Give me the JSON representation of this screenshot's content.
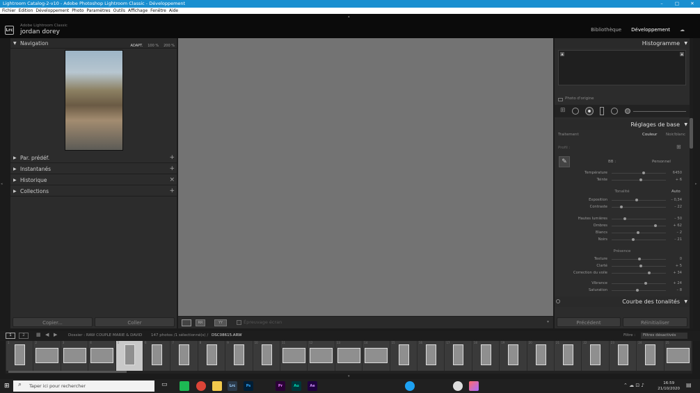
{
  "window": {
    "title": "Lightroom Catalog-2-v10 - Adobe Photoshop Lightroom Classic - Développement",
    "min": "–",
    "max": "□",
    "close": "✕"
  },
  "menu": [
    "Fichier",
    "Edition",
    "Développement",
    "Photo",
    "Paramètres",
    "Outils",
    "Affichage",
    "Fenêtre",
    "Aide"
  ],
  "identity": {
    "logo": "Lrc",
    "app": "Adobe Lightroom Classic",
    "user": "jordan dorey",
    "modules": [
      "Bibliothèque",
      "Développement"
    ],
    "active_module": "Développement"
  },
  "left": {
    "navigator": "Navigation",
    "zoom": [
      "ADAPT.",
      "100 %",
      "200 %"
    ],
    "panels": [
      "Par. prédéf.",
      "Instantanés",
      "Historique",
      "Collections"
    ],
    "copy": "Copier...",
    "paste": "Coller"
  },
  "right": {
    "histogram": "Histogramme",
    "original_photo": "Photo d'origine",
    "basic": "Réglages de base",
    "treatment": "Traitement",
    "color": "Couleur",
    "bw": "Noir/blanc",
    "profile": "Profil :",
    "wb": "BB :",
    "wb_value": "Personnel",
    "tone": "Tonalité",
    "auto": "Auto",
    "presence": "Présence",
    "curve": "Courbe des tonalités",
    "prev": "Précédent",
    "reset": "Réinitialiser",
    "wb_sliders": [
      {
        "label": "Température",
        "value": "6450",
        "pos": 0.58
      },
      {
        "label": "Teinte",
        "value": "+ 6",
        "pos": 0.52
      }
    ],
    "tone_sliders": [
      {
        "label": "Exposition",
        "value": "– 0,34",
        "pos": 0.45
      },
      {
        "label": "Contraste",
        "value": "– 22",
        "pos": 0.16
      }
    ],
    "light_sliders": [
      {
        "label": "Hautes lumières",
        "value": "– 50",
        "pos": 0.22
      },
      {
        "label": "Ombres",
        "value": "+ 62",
        "pos": 0.8
      },
      {
        "label": "Blancs",
        "value": "– 2",
        "pos": 0.48
      },
      {
        "label": "Noirs",
        "value": "– 21",
        "pos": 0.38
      }
    ],
    "presence_sliders": [
      {
        "label": "Texture",
        "value": "0",
        "pos": 0.5
      },
      {
        "label": "Clarté",
        "value": "+ 5",
        "pos": 0.53
      },
      {
        "label": "Correction du voile",
        "value": "+ 34",
        "pos": 0.68
      }
    ],
    "color_sliders": [
      {
        "label": "Vibrance",
        "value": "+ 24",
        "pos": 0.62
      },
      {
        "label": "Saturation",
        "value": "– 8",
        "pos": 0.46
      }
    ]
  },
  "toolbar": {
    "softproof": "Épreuvage écran"
  },
  "filmbar": {
    "screen1": "1",
    "screen2": "2",
    "path": "Dossier : RAW COUPLE MARIE & DAVID",
    "count": "147 photos /1 sélectionné(s) /",
    "file": "DSC08615.ARW",
    "filter": "Filtre :",
    "filter_value": "Filtres désactivés"
  },
  "filmstrip": {
    "cells": [
      {
        "n": "1",
        "o": "v"
      },
      {
        "n": "2",
        "o": "h"
      },
      {
        "n": "3",
        "o": "h"
      },
      {
        "n": "4",
        "o": "h"
      },
      {
        "n": "5",
        "o": "v",
        "sel": true
      },
      {
        "n": "6",
        "o": "v"
      },
      {
        "n": "7",
        "o": "v"
      },
      {
        "n": "8",
        "o": "v"
      },
      {
        "n": "9",
        "o": "v"
      },
      {
        "n": "10",
        "o": "v"
      },
      {
        "n": "11",
        "o": "h"
      },
      {
        "n": "12",
        "o": "h"
      },
      {
        "n": "13",
        "o": "h"
      },
      {
        "n": "14",
        "o": "h"
      },
      {
        "n": "15",
        "o": "v"
      },
      {
        "n": "16",
        "o": "v"
      },
      {
        "n": "17",
        "o": "v"
      },
      {
        "n": "18",
        "o": "v"
      },
      {
        "n": "19",
        "o": "v"
      },
      {
        "n": "20",
        "o": "v"
      },
      {
        "n": "21",
        "o": "v"
      },
      {
        "n": "22",
        "o": "v"
      },
      {
        "n": "23",
        "o": "v"
      },
      {
        "n": "24",
        "o": "v"
      },
      {
        "n": "25",
        "o": "h"
      }
    ]
  },
  "taskbar": {
    "search": "Taper ici pour rechercher",
    "time": "16:59",
    "date": "21/10/2020",
    "apps": [
      "Lrc",
      "Ps",
      "Pr",
      "Au",
      "Ae"
    ]
  },
  "colors": {
    "titlebar": "#1a8fd0",
    "panel": "#2c2c2c",
    "canvas": "#737373"
  }
}
